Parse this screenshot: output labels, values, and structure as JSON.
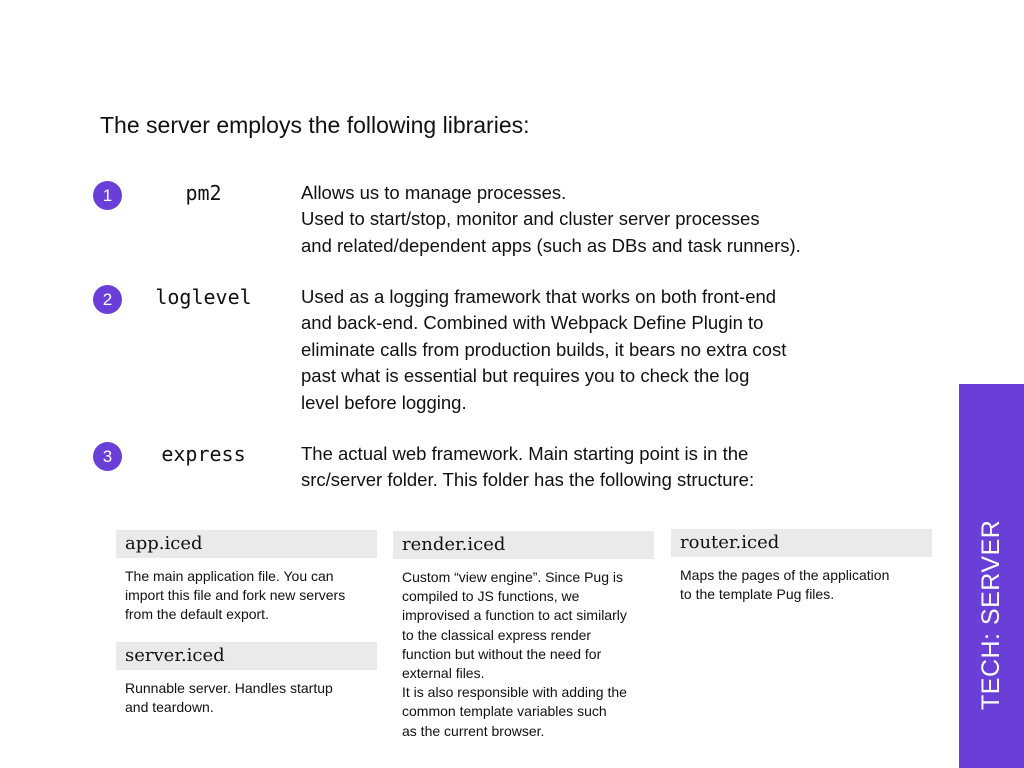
{
  "intro": "The server employs the following libraries:",
  "libraries": [
    {
      "number": "1",
      "name": "pm2",
      "lines": [
        "Allows us to manage processes.",
        "Used to start/stop, monitor and cluster server processes",
        "and related/dependent apps (such as DBs and task runners)."
      ]
    },
    {
      "number": "2",
      "name": "loglevel",
      "lines": [
        "Used as a logging framework that works on both front-end",
        "and back-end. Combined with Webpack Define Plugin to",
        "eliminate calls from production builds, it bears no extra cost",
        "past what is essential but requires you to check the log",
        "level before logging."
      ]
    },
    {
      "number": "3",
      "name": "express",
      "lines": [
        "The actual web framework. Main starting point is in the",
        "src/server folder. This folder has the following structure:"
      ]
    }
  ],
  "files": {
    "app": {
      "name": "app.iced",
      "lines": [
        "The main application file. You can",
        "import this file and fork new servers",
        "from the default export."
      ]
    },
    "server": {
      "name": "server.iced",
      "lines": [
        "Runnable server. Handles startup",
        "and teardown."
      ]
    },
    "render": {
      "name": "render.iced",
      "lines": [
        "Custom “view engine”. Since Pug is",
        "compiled to JS functions, we",
        "improvised a function to act similarly",
        "to the classical express render",
        "function but without the need for",
        "external files.",
        "It is also responsible with adding the",
        "common template variables such",
        "as the current browser."
      ]
    },
    "router": {
      "name": "router.iced",
      "lines": [
        "Maps the pages of the application",
        "to the template Pug files."
      ]
    }
  },
  "side_label": "TECH: SERVER",
  "colors": {
    "accent": "#6a3fd8",
    "file_header_bg": "#eaeaea"
  }
}
